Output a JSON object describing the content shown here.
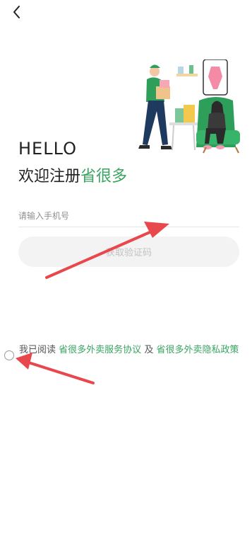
{
  "nav": {
    "back_icon": "chevron-left-icon"
  },
  "hero": {
    "illustration": "delivery-courier-and-shopper-illustration"
  },
  "greeting": {
    "hello": "HELLO",
    "welcome_prefix": "欢迎注册",
    "brand": "省很多"
  },
  "phone": {
    "placeholder": "请输入手机号",
    "value": ""
  },
  "code_button": {
    "label": "获取验证码"
  },
  "agreement": {
    "prefix": "我已阅读",
    "service_link": "省很多外卖服务协议",
    "conjunction": "及",
    "privacy_link": "省很多外卖隐私政策",
    "checked": false
  },
  "annotations": {
    "arrow_color": "#e8474c"
  },
  "colors": {
    "brand_green": "#3aa461",
    "button_bg": "#f3f3f3"
  }
}
